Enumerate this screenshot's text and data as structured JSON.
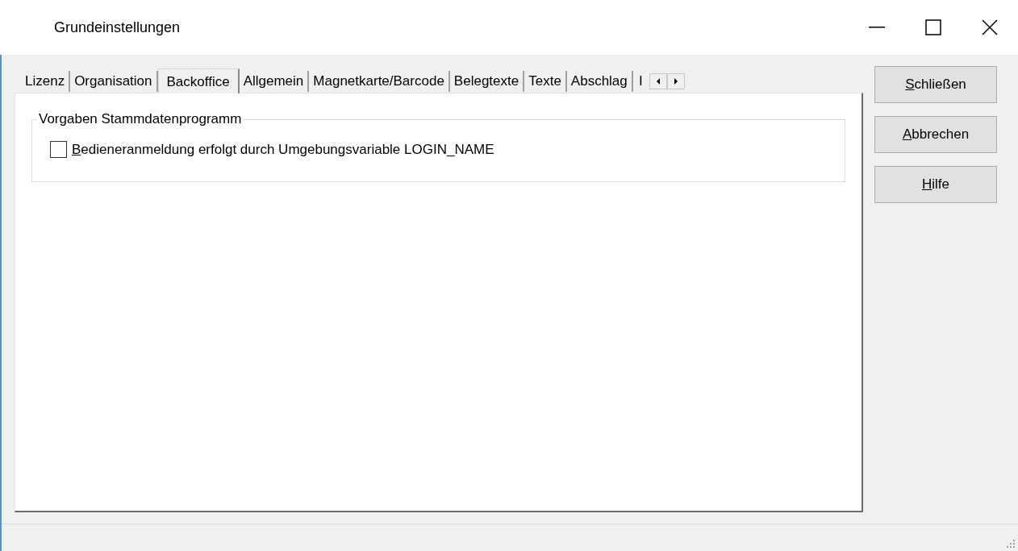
{
  "window": {
    "title": "Grundeinstellungen"
  },
  "tabs": [
    {
      "label": "Lizenz",
      "selected": false
    },
    {
      "label": "Organisation",
      "selected": false
    },
    {
      "label": "Backoffice",
      "selected": true
    },
    {
      "label": "Allgemein",
      "selected": false
    },
    {
      "label": "Magnetkarte/Barcode",
      "selected": false
    },
    {
      "label": "Belegtexte",
      "selected": false
    },
    {
      "label": "Texte",
      "selected": false
    },
    {
      "label": "Abschlag",
      "selected": false
    },
    {
      "label": "I",
      "selected": false
    }
  ],
  "group": {
    "title": "Vorgaben Stammdatenprogramm",
    "checkbox": {
      "label": "Bedieneranmeldung erfolgt durch Umgebungsvariable LOGIN_NAME",
      "checked": false
    }
  },
  "buttons": [
    "Schließen",
    "Abbrechen",
    "Hilfe"
  ]
}
